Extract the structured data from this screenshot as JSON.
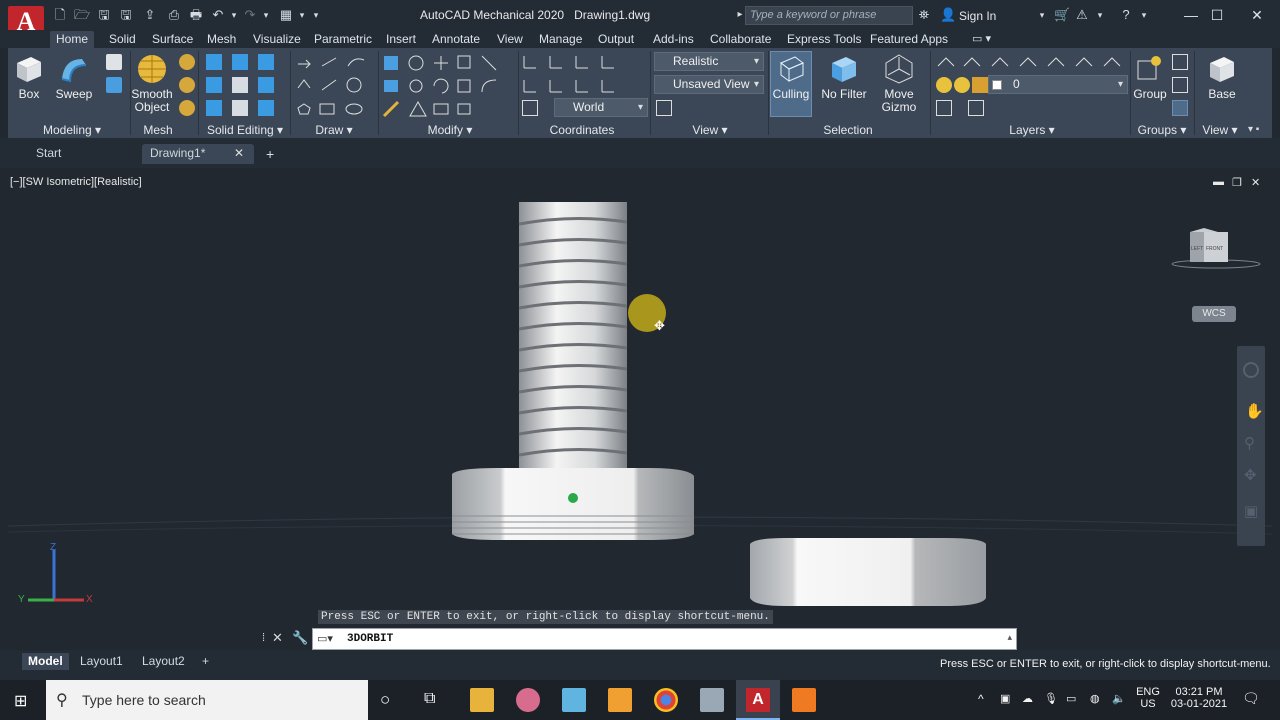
{
  "app": {
    "logo_letter": "A",
    "logo_sub": "M",
    "title": "AutoCAD Mechanical 2020",
    "file": "Drawing1.dwg"
  },
  "search": {
    "placeholder": "Type a keyword or phrase"
  },
  "account": {
    "sign_in": "Sign In"
  },
  "ribbon_tabs": [
    "Home",
    "Solid",
    "Surface",
    "Mesh",
    "Visualize",
    "Parametric",
    "Insert",
    "Annotate",
    "View",
    "Manage",
    "Output",
    "Add-ins",
    "Collaborate",
    "Express Tools",
    "Featured Apps"
  ],
  "ribbon": {
    "box": "Box",
    "sweep": "Sweep",
    "smooth": "Smooth",
    "object": "Object",
    "visual_style": "Realistic",
    "view_name": "Unsaved View",
    "ucs": "World",
    "culling": "Culling",
    "no_filter": "No Filter",
    "move": "Move",
    "gizmo": "Gizmo",
    "layer_value": "0",
    "group": "Group",
    "base": "Base",
    "panels": {
      "modeling": "Modeling",
      "mesh": "Mesh",
      "solid_editing": "Solid Editing",
      "draw": "Draw",
      "modify": "Modify",
      "coordinates": "Coordinates",
      "view": "View",
      "selection": "Selection",
      "layers": "Layers",
      "groups": "Groups",
      "view2": "View"
    }
  },
  "file_tabs": {
    "start": "Start",
    "drawing": "Drawing1*"
  },
  "viewport": {
    "label": "[−][SW Isometric][Realistic]",
    "wcs": "WCS",
    "cube_left": "LEFT",
    "cube_front": "FRONT"
  },
  "command": {
    "hint": "Press ESC or ENTER to exit, or right-click to display shortcut-menu.",
    "current": "3DORBIT"
  },
  "layout_tabs": {
    "model": "Model",
    "layout1": "Layout1",
    "layout2": "Layout2"
  },
  "status": {
    "message": "Press ESC or ENTER to exit, or right-click to display shortcut-menu."
  },
  "taskbar": {
    "search_placeholder": "Type here to search",
    "lang": "ENG",
    "region": "US",
    "time": "03:21 PM",
    "date": "03-01-2021"
  },
  "colors": {
    "app_red": "#c0262b",
    "ribbon_bg": "#3b4756",
    "canvas": "#212830"
  }
}
